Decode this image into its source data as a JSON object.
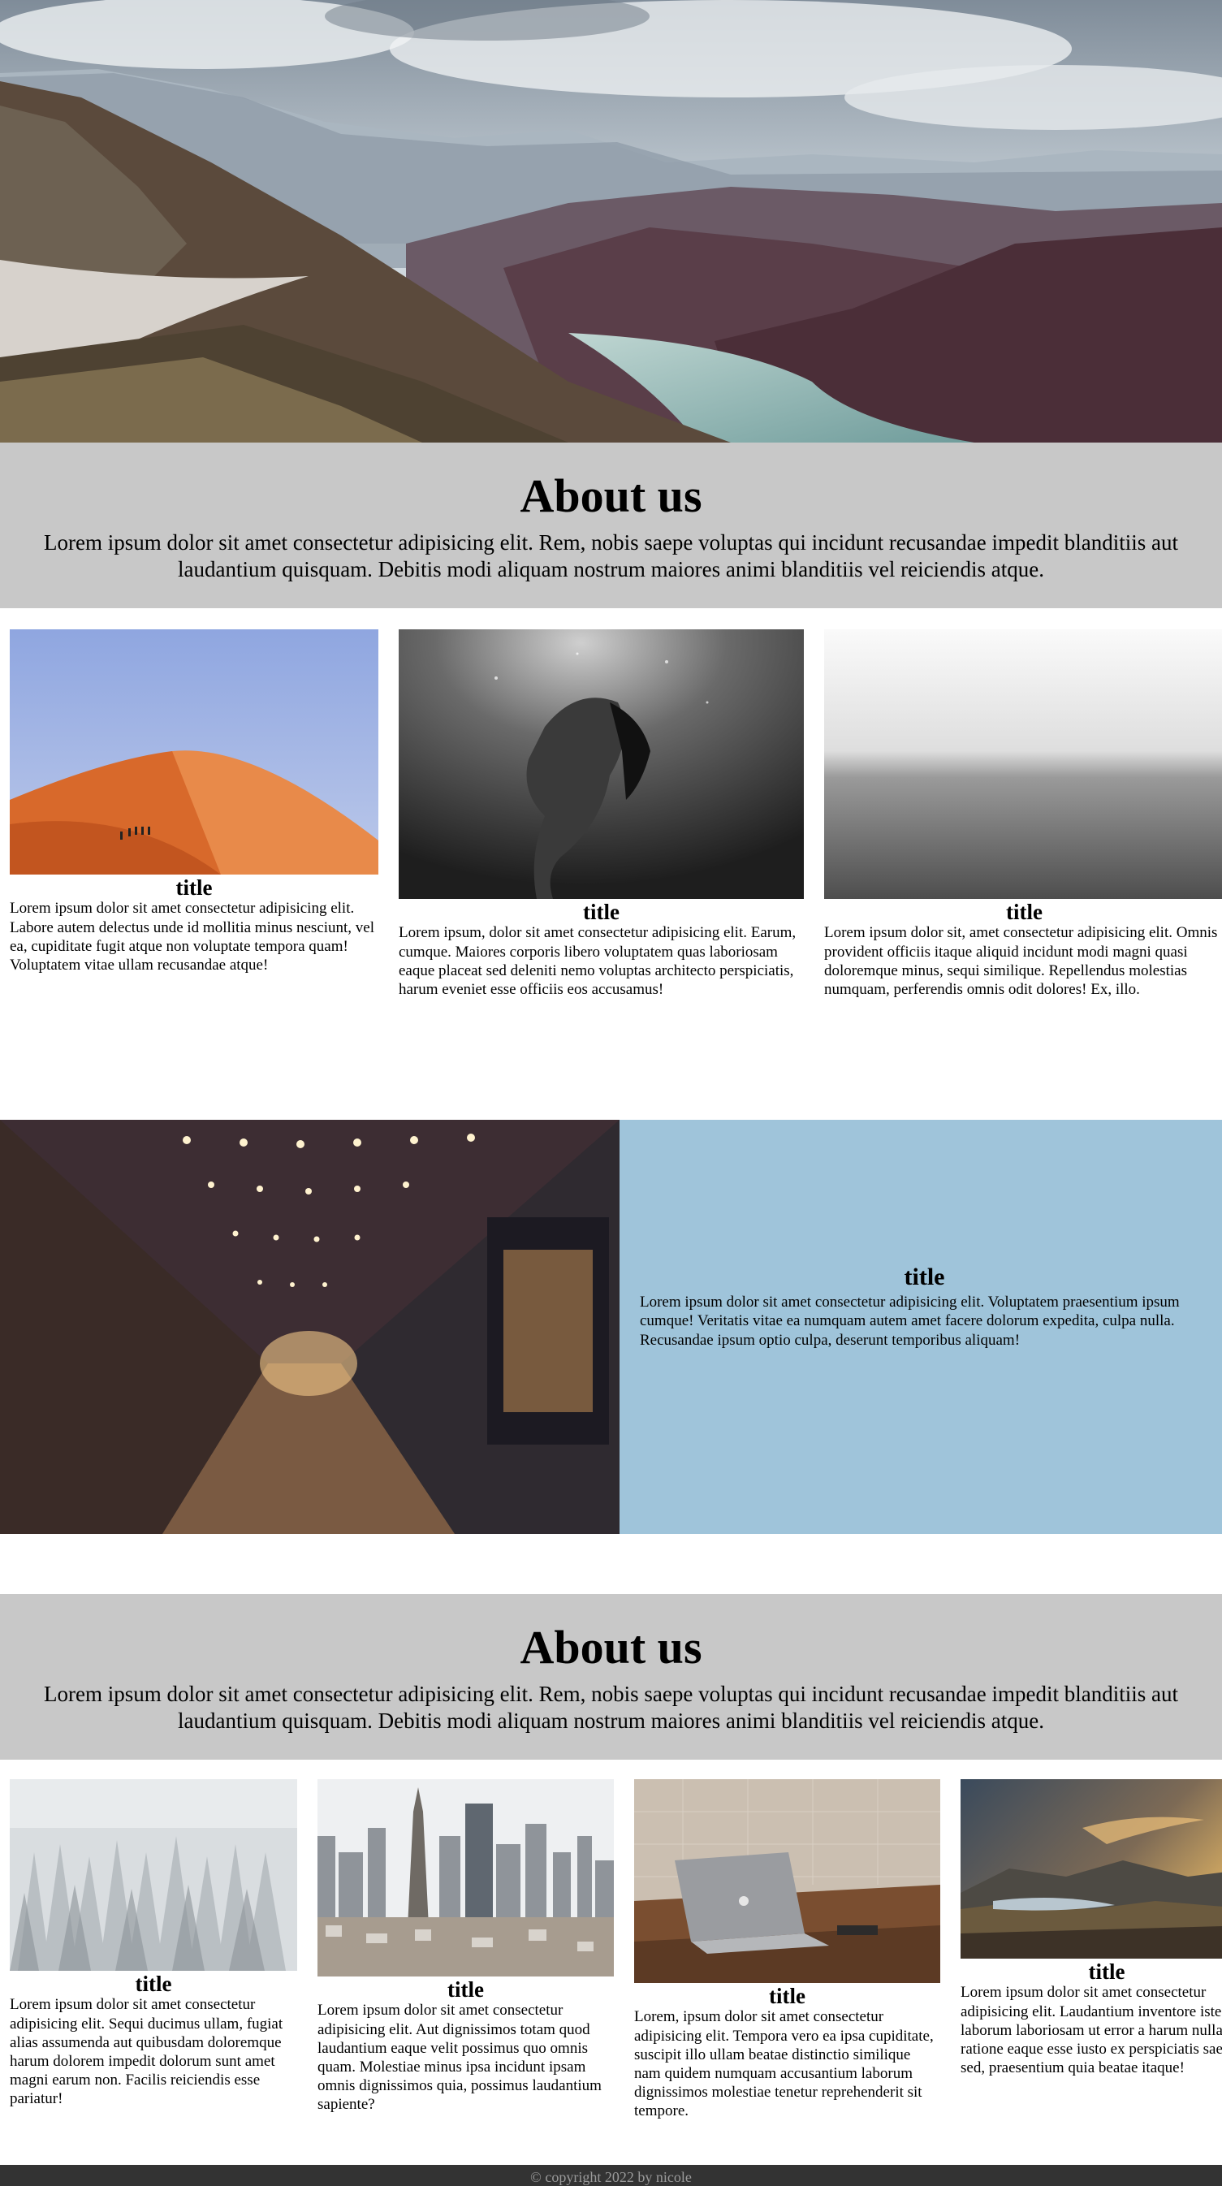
{
  "about_top": {
    "heading": "About us",
    "text": "Lorem ipsum dolor sit amet consectetur adipisicing elit. Rem, nobis saepe voluptas qui incidunt recusandae impedit blanditiis aut laudantium quisquam. Debitis modi aliquam nostrum maiores animi blanditiis vel reiciendis atque."
  },
  "cards_row1": [
    {
      "title": "title",
      "text": "Lorem ipsum dolor sit amet consectetur adipisicing elit. Labore autem delectus unde id mollitia minus nesciunt, vel ea, cupiditate fugit atque non voluptate tempora quam! Voluptatem vitae ullam recusandae atque!"
    },
    {
      "title": "title",
      "text": "Lorem ipsum, dolor sit amet consectetur adipisicing elit. Earum, cumque. Maiores corporis libero voluptatem quas laboriosam eaque placeat sed deleniti nemo voluptas architecto perspiciatis, harum eveniet esse officiis eos accusamus!"
    },
    {
      "title": "title",
      "text": "Lorem ipsum dolor sit, amet consectetur adipisicing elit. Omnis provident officiis itaque aliquid incidunt modi magni quasi doloremque minus, sequi similique. Repellendus molestias numquam, perferendis omnis odit dolores! Ex, illo."
    }
  ],
  "feature": {
    "title": "title",
    "text": "Lorem ipsum dolor sit amet consectetur adipisicing elit. Voluptatem praesentium ipsum cumque! Veritatis vitae ea numquam autem amet facere dolorum expedita, culpa nulla. Recusandae ipsum optio culpa, deserunt temporibus aliquam!"
  },
  "about_bottom": {
    "heading": "About us",
    "text": "Lorem ipsum dolor sit amet consectetur adipisicing elit. Rem, nobis saepe voluptas qui incidunt recusandae impedit blanditiis aut laudantium quisquam. Debitis modi aliquam nostrum maiores animi blanditiis vel reiciendis atque."
  },
  "cards_row2": [
    {
      "title": "title",
      "text": "Lorem ipsum dolor sit amet consectetur adipisicing elit. Sequi ducimus ullam, fugiat alias assumenda aut quibusdam doloremque harum dolorem impedit dolorum sunt amet magni earum non. Facilis reiciendis esse pariatur!"
    },
    {
      "title": "title",
      "text": "Lorem ipsum dolor sit amet consectetur adipisicing elit. Aut dignissimos totam quod laudantium eaque velit possimus quo omnis quam. Molestiae minus ipsa incidunt ipsam omnis dignissimos quia, possimus laudantium sapiente?"
    },
    {
      "title": "title",
      "text": "Lorem, ipsum dolor sit amet consectetur adipisicing elit. Tempora vero ea ipsa cupiditate, suscipit illo ullam beatae distinctio similique nam quidem numquam accusantium laborum dignissimos molestiae tenetur reprehenderit sit tempore."
    },
    {
      "title": "title",
      "text": "Lorem ipsum dolor sit amet consectetur adipisicing elit. Laudantium inventore iste laborum laboriosam ut error a harum nulla ratione eaque esse iusto ex perspiciatis saepe sed, praesentium quia beatae itaque!"
    }
  ],
  "footer": {
    "text": "© copyright 2022 by nicole"
  },
  "colors": {
    "about_bg": "#c8c8c8",
    "feature_bg": "#9fc4da",
    "footer_bg": "#333333"
  }
}
